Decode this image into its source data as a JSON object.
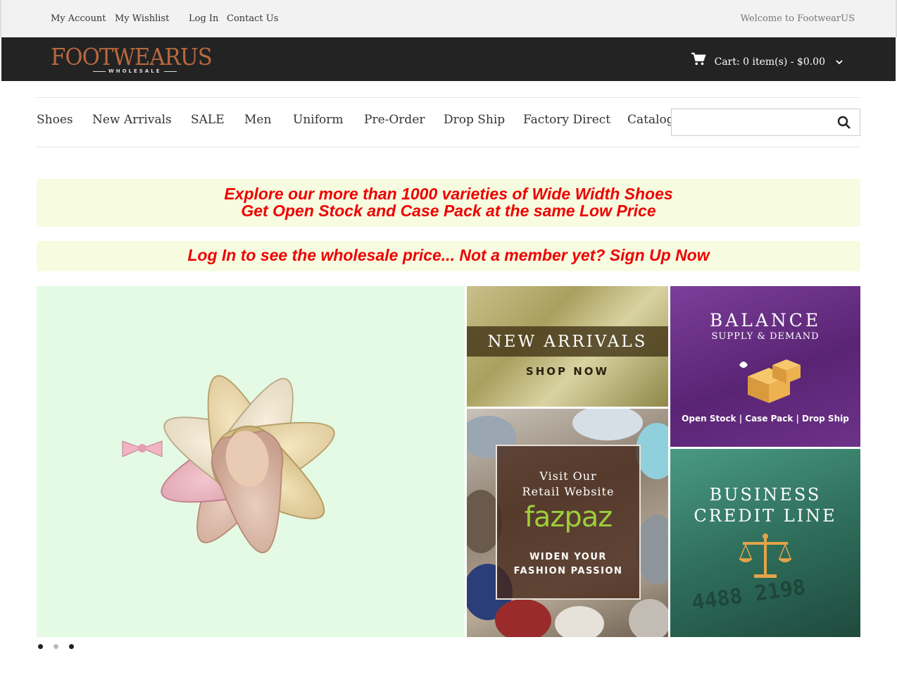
{
  "topbar": {
    "my_account": "My Account",
    "my_wishlist": "My Wishlist",
    "log_in": "Log In",
    "contact_us": "Contact Us",
    "welcome": "Welcome to FootwearUS"
  },
  "header": {
    "logo_text": "FOOTWEARUS",
    "logo_sub": "WHOLESALE",
    "cart_label": "Cart: 0 item(s) - $0.00",
    "brand_color": "#b8693f"
  },
  "nav": {
    "items": [
      "Shoes",
      "New Arrivals",
      "SALE",
      "Men",
      "Uniform",
      "Pre-Order",
      "Drop Ship",
      "Factory Direct",
      "Catalog"
    ],
    "search_placeholder": ""
  },
  "promo": {
    "line1": "Explore our more than 1000 varieties of Wide Width Shoes",
    "line2": "Get Open Stock and Case Pack at the same Low Price",
    "login_line": "Log In to see the wholesale price... Not a member yet? Sign Up Now",
    "text_color": "#ee0000",
    "bg_color": "#f7fce0"
  },
  "tiles": {
    "new_arrivals": {
      "title": "NEW ARRIVALS",
      "cta": "SHOP NOW"
    },
    "fazpaz": {
      "visit_line1": "Visit Our",
      "visit_line2": "Retail Website",
      "logo": "fazpaz",
      "tag_line1": "WIDEN YOUR",
      "tag_line2": "FASHION PASSION"
    },
    "balance": {
      "title": "BALANCE",
      "subtitle": "SUPPLY & DEMAND",
      "footer": "Open Stock | Case Pack | Drop Ship"
    },
    "business": {
      "line1": "BUSINESS",
      "line2": "CREDIT LINE",
      "card_number": "4488 2198"
    }
  },
  "carousel": {
    "slides": 3,
    "active_index": 0
  }
}
